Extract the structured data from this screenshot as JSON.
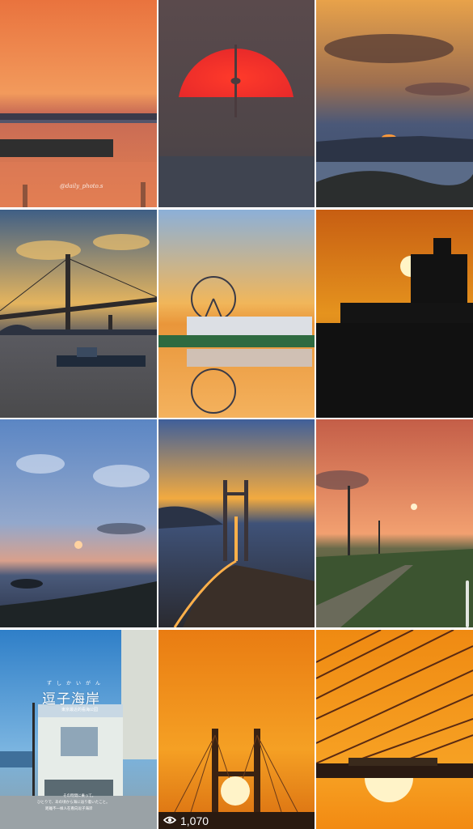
{
  "grid": {
    "tiles": [
      {
        "name": "sunset-bridge-pier"
      },
      {
        "name": "red-sun-tower"
      },
      {
        "name": "cloudy-sunset-islands"
      },
      {
        "name": "suspension-bridge-boats"
      },
      {
        "name": "ferris-wheel-reflection"
      },
      {
        "name": "sun-building-silhouette"
      },
      {
        "name": "blue-sky-sunset-sea"
      },
      {
        "name": "cable-bridge-highway"
      },
      {
        "name": "sun-powerlines-road"
      },
      {
        "name": "zushi-beach-shop"
      },
      {
        "name": "orange-bridge-tower-sun"
      },
      {
        "name": "bridge-cables-train-sun"
      }
    ]
  },
  "watermark": "@daily_photo.s",
  "zushi": {
    "kana": "ずしかいがん",
    "title": "逗子海岸",
    "subtitle": "東京最近的看海公园",
    "caption_line1": "その時間に乗って。",
    "caption_line2": "ひとりで、あの頃から海に辿り着いたこと。",
    "caption_line3": "距離不一样人在看向逗子海岸"
  },
  "views": {
    "count": "1,070",
    "icon": "eye-icon"
  },
  "colors": {
    "scrollbar": "#ffffff"
  }
}
